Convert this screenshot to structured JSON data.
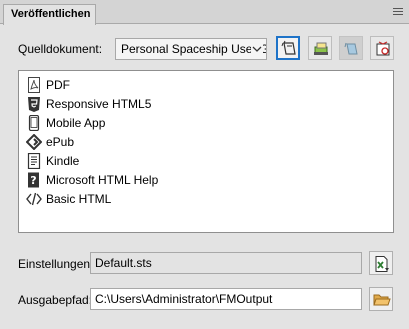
{
  "panel": {
    "tab_label": "Veröffentlichen"
  },
  "source": {
    "label": "Quelldokument:",
    "selected": "Personal Spaceship User G"
  },
  "toolbar": {
    "icons": [
      "publish-toc-icon",
      "generate-icon",
      "disabled-tool-icon",
      "output-settings-icon"
    ]
  },
  "outputs": [
    {
      "label": "PDF",
      "icon": "pdf-icon"
    },
    {
      "label": "Responsive HTML5",
      "icon": "html5-icon"
    },
    {
      "label": "Mobile App",
      "icon": "mobile-icon"
    },
    {
      "label": "ePub",
      "icon": "epub-icon"
    },
    {
      "label": "Kindle",
      "icon": "kindle-icon"
    },
    {
      "label": "Microsoft HTML Help",
      "icon": "htmlhelp-icon"
    },
    {
      "label": "Basic HTML",
      "icon": "code-icon"
    }
  ],
  "settings": {
    "label": "Einstellungen:",
    "value": "Default.sts"
  },
  "output_path": {
    "label": "Ausgabepfad:",
    "value": "C:\\Users\\Administrator\\FMOutput"
  },
  "colors": {
    "accent": "#1e73c8",
    "panel_bg": "#e3e3e3"
  }
}
